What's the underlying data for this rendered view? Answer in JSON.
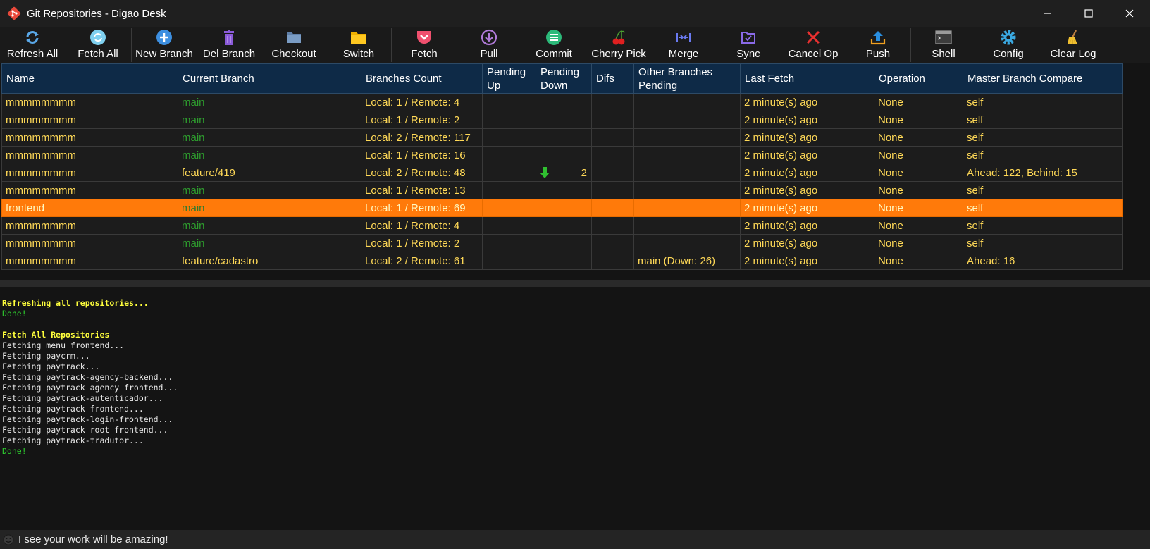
{
  "window": {
    "title": "Git Repositories - Digao Desk"
  },
  "toolbar": {
    "refresh_all": "Refresh All",
    "fetch_all": "Fetch All",
    "new_branch": "New Branch",
    "del_branch": "Del Branch",
    "checkout": "Checkout",
    "switch": "Switch",
    "fetch": "Fetch",
    "pull": "Pull",
    "commit": "Commit",
    "cherry_pick": "Cherry Pick",
    "merge": "Merge",
    "sync": "Sync",
    "cancel_op": "Cancel Op",
    "push": "Push",
    "shell": "Shell",
    "config": "Config",
    "clear_log": "Clear Log"
  },
  "grid": {
    "columns": {
      "name": "Name",
      "current_branch": "Current Branch",
      "branches_count": "Branches Count",
      "pending_up": "Pending Up",
      "pending_down": "Pending Down",
      "difs": "Difs",
      "other_branches_pending": "Other Branches Pending",
      "last_fetch": "Last Fetch",
      "operation": "Operation",
      "master_branch_compare": "Master Branch Compare"
    },
    "rows": [
      {
        "name": "mmmmmmmm",
        "branch": "main",
        "count": "Local: 1 / Remote: 4",
        "pending_up": "",
        "pending_down": "",
        "difs": "",
        "other": "",
        "last_fetch": "2 minute(s) ago",
        "operation": "None",
        "compare": "self"
      },
      {
        "name": "mmmmmmmm",
        "branch": "main",
        "count": "Local: 1 / Remote: 2",
        "pending_up": "",
        "pending_down": "",
        "difs": "",
        "other": "",
        "last_fetch": "2 minute(s) ago",
        "operation": "None",
        "compare": "self"
      },
      {
        "name": "mmmmmmmm",
        "branch": "main",
        "count": "Local: 2 / Remote: 117",
        "pending_up": "",
        "pending_down": "",
        "difs": "",
        "other": "",
        "last_fetch": "2 minute(s) ago",
        "operation": "None",
        "compare": "self"
      },
      {
        "name": "mmmmmmmm",
        "branch": "main",
        "count": "Local: 1 / Remote: 16",
        "pending_up": "",
        "pending_down": "",
        "difs": "",
        "other": "",
        "last_fetch": "2 minute(s) ago",
        "operation": "None",
        "compare": "self"
      },
      {
        "name": "mmmmmmmm",
        "branch": "feature/419",
        "count": "Local: 2 / Remote: 48",
        "pending_up": "",
        "pending_down": "2",
        "difs": "",
        "other": "",
        "last_fetch": "2 minute(s) ago",
        "operation": "None",
        "compare": "Ahead: 122, Behind: 15"
      },
      {
        "name": "mmmmmmmm",
        "branch": "main",
        "count": "Local: 1 / Remote: 13",
        "pending_up": "",
        "pending_down": "",
        "difs": "",
        "other": "",
        "last_fetch": "2 minute(s) ago",
        "operation": "None",
        "compare": "self"
      },
      {
        "name": "frontend",
        "branch": "main",
        "count": "Local: 1 / Remote: 69",
        "pending_up": "",
        "pending_down": "",
        "difs": "",
        "other": "",
        "last_fetch": "2 minute(s) ago",
        "operation": "None",
        "compare": "self"
      },
      {
        "name": "mmmmmmmm",
        "branch": "main",
        "count": "Local: 1 / Remote: 4",
        "pending_up": "",
        "pending_down": "",
        "difs": "",
        "other": "",
        "last_fetch": "2 minute(s) ago",
        "operation": "None",
        "compare": "self"
      },
      {
        "name": "mmmmmmmm",
        "branch": "main",
        "count": "Local: 1 / Remote: 2",
        "pending_up": "",
        "pending_down": "",
        "difs": "",
        "other": "",
        "last_fetch": "2 minute(s) ago",
        "operation": "None",
        "compare": "self"
      },
      {
        "name": "mmmmmmmm",
        "branch": "feature/cadastro",
        "count": "Local: 2 / Remote: 61",
        "pending_up": "",
        "pending_down": "",
        "difs": "",
        "other": "main (Down: 26)",
        "last_fetch": "2 minute(s) ago",
        "operation": "None",
        "compare": "Ahead: 16"
      }
    ]
  },
  "log": {
    "lines": [
      "Refreshing all repositories...",
      "Done!",
      "",
      "Fetch All Repositories",
      "Fetching menu frontend...",
      "Fetching paycrm...",
      "Fetching paytrack...",
      "Fetching paytrack-agency-backend...",
      "Fetching paytrack agency frontend...",
      "Fetching paytrack-autenticador...",
      "Fetching paytrack frontend...",
      "Fetching paytrack-login-frontend...",
      "Fetching paytrack root frontend...",
      "Fetching paytrack-tradutor...",
      "Done!"
    ]
  },
  "status": {
    "text": "I see your work will be amazing!"
  },
  "colors": {
    "accent_selected": "#ff7a0a",
    "header_bg": "#0e2a47",
    "text_yellow": "#ffd957",
    "branch_green": "#2e9e2e"
  }
}
